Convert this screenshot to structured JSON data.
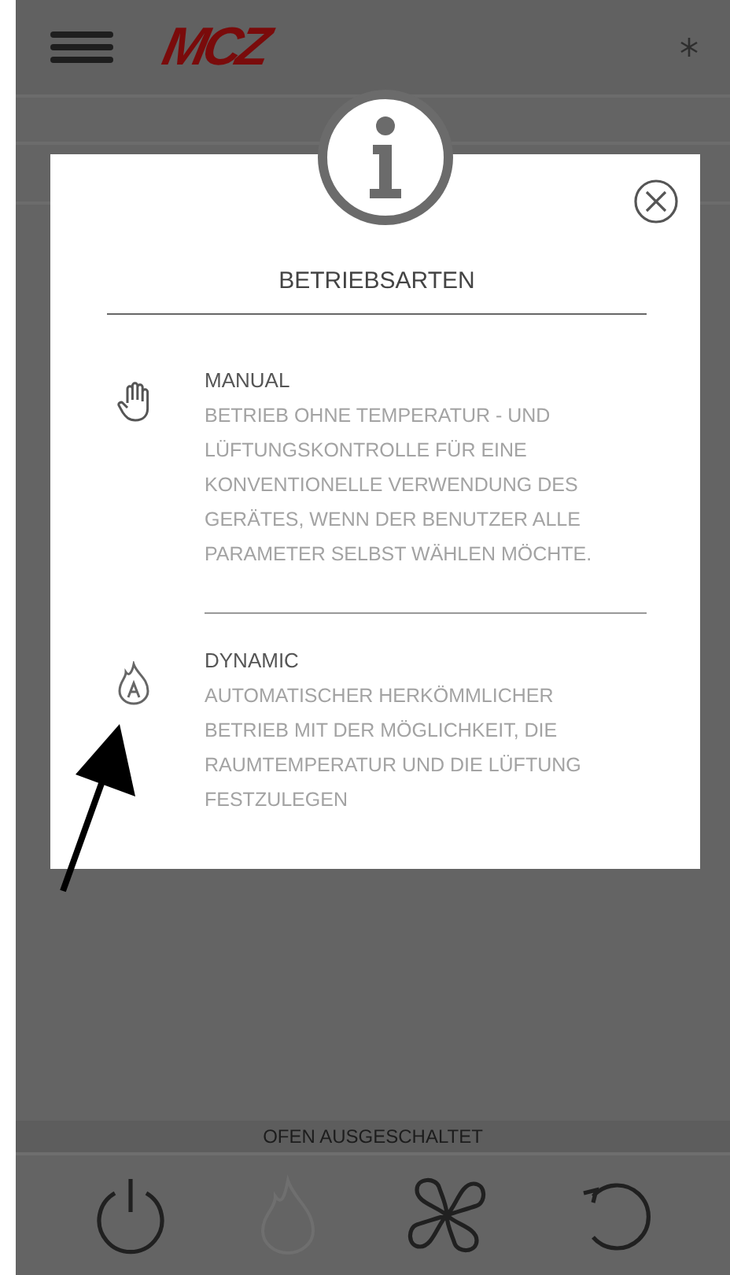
{
  "header": {
    "logo": "MCZ"
  },
  "dialog": {
    "title": "BETRIEBSARTEN",
    "modes": [
      {
        "kind": "hand",
        "name": "MANUAL",
        "description": "BETRIEB OHNE TEMPERATUR - UND LÜFTUNGSKONTROLLE FÜR EINE KONVENTIONELLE VERWENDUNG DES GERÄTES, WENN DER BENUTZER ALLE PARAMETER SELBST WÄHLEN MÖCHTE."
      },
      {
        "kind": "flame",
        "name": "DYNAMIC",
        "description": "AUTOMATISCHER HERKÖMMLICHER BETRIEB MIT DER MÖGLICHKEIT, DIE RAUMTEMPERATUR UND DIE LÜFTUNG FESTZULEGEN"
      }
    ]
  },
  "status_bar": "OFEN AUSGESCHALTET",
  "bottom_buttons": [
    {
      "kind": "power",
      "disabled": false
    },
    {
      "kind": "flame",
      "disabled": true
    },
    {
      "kind": "fan",
      "disabled": false
    },
    {
      "kind": "undo",
      "disabled": false
    }
  ]
}
